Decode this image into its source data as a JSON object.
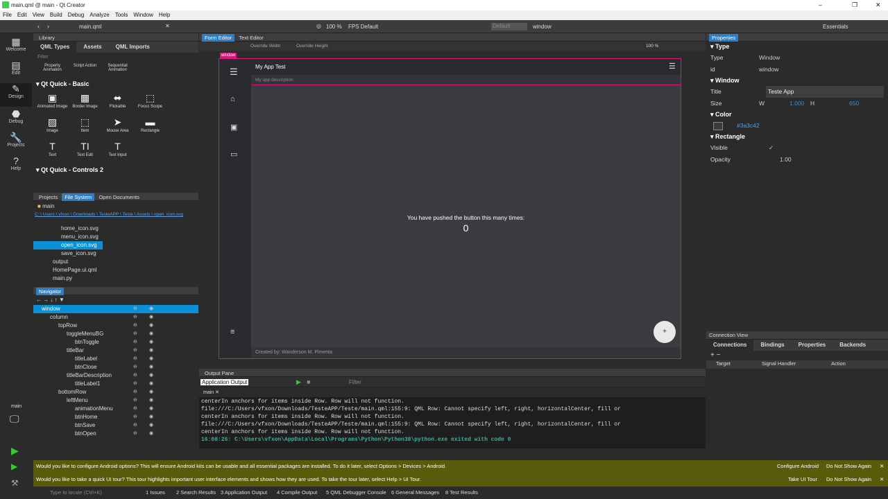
{
  "window": {
    "title": "main.qml @ main - Qt Creator",
    "minimize": "–",
    "maximize": "❐",
    "close": "✕"
  },
  "menu": [
    "File",
    "Edit",
    "View",
    "Build",
    "Debug",
    "Analyze",
    "Tools",
    "Window",
    "Help"
  ],
  "toolbar": {
    "file": "main.qml",
    "zoom": "100 %",
    "fps": "FPS Default",
    "state": "Default",
    "scope": "window",
    "kit": "Essentials"
  },
  "modes": [
    {
      "label": "Welcome",
      "icon": "▦"
    },
    {
      "label": "Edit",
      "icon": "▤"
    },
    {
      "label": "Design",
      "icon": "✎"
    },
    {
      "label": "Debug",
      "icon": "⬣"
    },
    {
      "label": "Projects",
      "icon": "🔧"
    },
    {
      "label": "Help",
      "icon": "?"
    }
  ],
  "library": {
    "header": "Library",
    "tabs": [
      "QML Types",
      "Assets",
      "QML Imports"
    ],
    "filter": "Filter",
    "top_items": [
      "Property Animation",
      "Script Action",
      "Sequential Animation"
    ],
    "section1": "Qt Quick - Basic",
    "basic_items": [
      {
        "label": "Animated Image",
        "icon": "▣"
      },
      {
        "label": "Border Image",
        "icon": "▩"
      },
      {
        "label": "Flickable",
        "icon": "⬌"
      },
      {
        "label": "Focus Scope",
        "icon": "⬚"
      },
      {
        "label": "Image",
        "icon": "▨"
      },
      {
        "label": "Item",
        "icon": "⬚"
      },
      {
        "label": "Mouse Area",
        "icon": "➤"
      },
      {
        "label": "Rectangle",
        "icon": "▬"
      },
      {
        "label": "Text",
        "icon": "T"
      },
      {
        "label": "Text Edit",
        "icon": "TI"
      },
      {
        "label": "Text Input",
        "icon": "T"
      }
    ],
    "section2": "Qt Quick - Controls 2"
  },
  "filesystem": {
    "tabs": [
      "Projects",
      "File System",
      "Open Documents"
    ],
    "folder": "main",
    "path": "C: \\ Users \\ vfxon \\ Downloads \\ TesteAPP \\ Teste \\ Assets \\ open_icon.svg",
    "files": [
      "home_icon.svg",
      "menu_icon.svg",
      "open_icon.svg",
      "save_icon.svg",
      "output",
      "HomePage.ui.qml",
      "main.py"
    ]
  },
  "navigator": {
    "header": "Navigator",
    "items": [
      {
        "label": "window",
        "depth": 0
      },
      {
        "label": "column",
        "depth": 1
      },
      {
        "label": "topRow",
        "depth": 2
      },
      {
        "label": "toggleMenuBG",
        "depth": 3
      },
      {
        "label": "btnToggle",
        "depth": 4
      },
      {
        "label": "titleBar",
        "depth": 3
      },
      {
        "label": "titleLabel",
        "depth": 4
      },
      {
        "label": "btnClose",
        "depth": 4
      },
      {
        "label": "titleBarDescription",
        "depth": 3
      },
      {
        "label": "titleLabel1",
        "depth": 4
      },
      {
        "label": "bottomRow",
        "depth": 2
      },
      {
        "label": "leftMenu",
        "depth": 3
      },
      {
        "label": "animationMenu",
        "depth": 4
      },
      {
        "label": "btnHome",
        "depth": 4
      },
      {
        "label": "btnSave",
        "depth": 4
      },
      {
        "label": "btnOpen",
        "depth": 4
      }
    ]
  },
  "editor": {
    "tabs": [
      "Form Editor",
      "Text Editor"
    ],
    "override_width": "Override Width",
    "override_height": "Override Height",
    "zoom": "100 %",
    "window_label": "window"
  },
  "app": {
    "title": "My App Test",
    "description": "My app description",
    "message": "You have pushed the button this many times:",
    "count": "0",
    "footer": "Created by: Wanderson M. Pimenta",
    "fab": "+"
  },
  "properties": {
    "header": "Properties",
    "type_section": "Type",
    "type_label": "Type",
    "type_value": "Window",
    "id_label": "id",
    "id_value": "window",
    "window_section": "Window",
    "title_label": "Title",
    "title_value": "Teste App",
    "size_label": "Size",
    "w_label": "W",
    "w_value": "1,000",
    "h_label": "H",
    "h_value": "650",
    "color_section": "Color",
    "color_value": "#3a3c42",
    "rect_section": "Rectangle",
    "visible_label": "Visible",
    "opacity_label": "Opacity",
    "opacity_value": "1.00"
  },
  "connection": {
    "header": "Connection View",
    "tabs": [
      "Connections",
      "Bindings",
      "Properties",
      "Backends"
    ],
    "cols": [
      "Target",
      "Signal Handler",
      "Action"
    ]
  },
  "output": {
    "header": "Output Pane",
    "app_output": "Application Output",
    "filter": "Filter",
    "tab": "main",
    "lines": [
      "centerIn anchors for items inside Row. Row will not function.",
      "file:///C:/Users/vfxon/Downloads/TesteAPP/Teste/main.qml:155:9: QML Row: Cannot specify left, right, horizontalCenter, fill or",
      "centerIn anchors for items inside Row. Row will not function.",
      "file:///C:/Users/vfxon/Downloads/TesteAPP/Teste/main.qml:155:9: QML Row: Cannot specify left, right, horizontalCenter, fill or",
      "centerIn anchors for items inside Row. Row will not function."
    ],
    "exit_line": "16:08:26: C:\\Users\\vfxon\\AppData\\Local\\Programs\\Python\\Python38\\python.exe exited with code 0"
  },
  "notifications": [
    {
      "text": "Would you like to configure Android options? This will ensure Android kits can be usable and all essential packages are installed. To do it later, select Options > Devices > Android.",
      "action": "Configure Android",
      "dismiss": "Do Not Show Again"
    },
    {
      "text": "Would you like to take a quick UI tour? This tour highlights important user interface elements and shows how they are used. To take the tour later, select Help > UI Tour.",
      "action": "Take UI Tour",
      "dismiss": "Do Not Show Again"
    }
  ],
  "status": {
    "locate": "Type to locate (Ctrl+K)",
    "panes": [
      "1 Issues",
      "2 Search Results",
      "3 Application Output",
      "4 Compile Output",
      "5 QML Debugger Console",
      "6 General Messages",
      "8 Test Results"
    ]
  },
  "kit_label": "main"
}
